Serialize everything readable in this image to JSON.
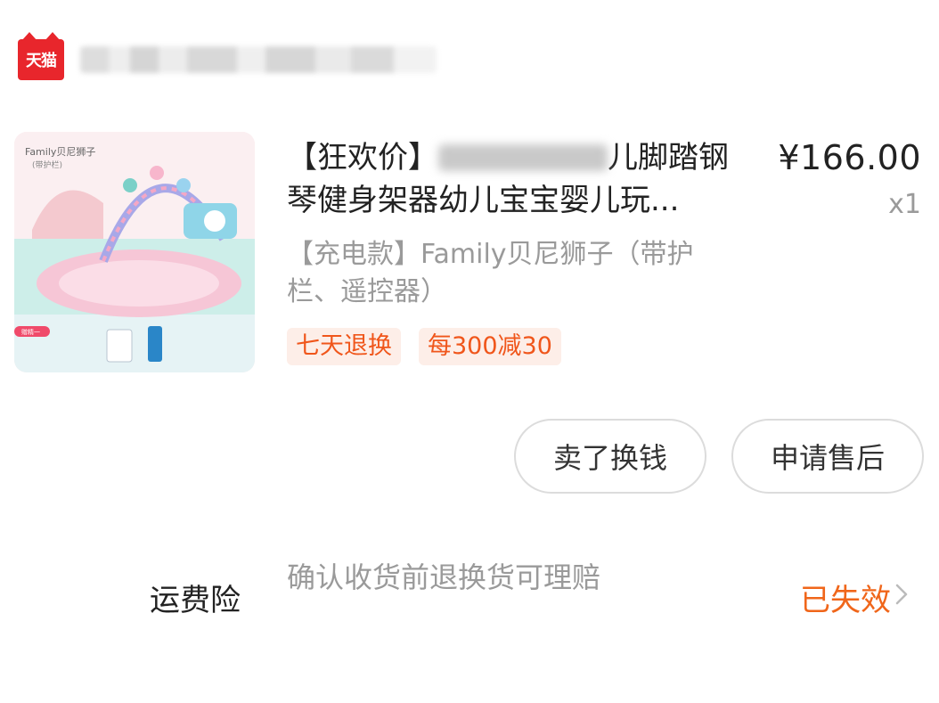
{
  "store": {
    "logo_text": "天猫",
    "name": ""
  },
  "product": {
    "title_prefix": "【狂欢价】",
    "title_after_blur": "儿脚踏钢",
    "title_line2": "琴健身架器幼儿宝宝婴儿玩...",
    "price": "¥166.00",
    "quantity": "x1",
    "spec": "【充电款】Family贝尼狮子（带护栏、遥控器）",
    "image": {
      "brand_text": "Family贝尼狮子",
      "sub_text": "(带护栏)",
      "badge": "赠精一"
    }
  },
  "tags": [
    {
      "label": "七天退换"
    },
    {
      "label": "每300减30"
    }
  ],
  "actions": {
    "sell_label": "卖了换钱",
    "after_sales_label": "申请售后"
  },
  "insurance": {
    "label": "运费险",
    "description": "确认收货前退换货可理赔",
    "status": "已失效"
  },
  "colors": {
    "brand_red": "#e8262c",
    "accent_orange": "#f0561b",
    "muted_gray": "#9a9a9a"
  }
}
